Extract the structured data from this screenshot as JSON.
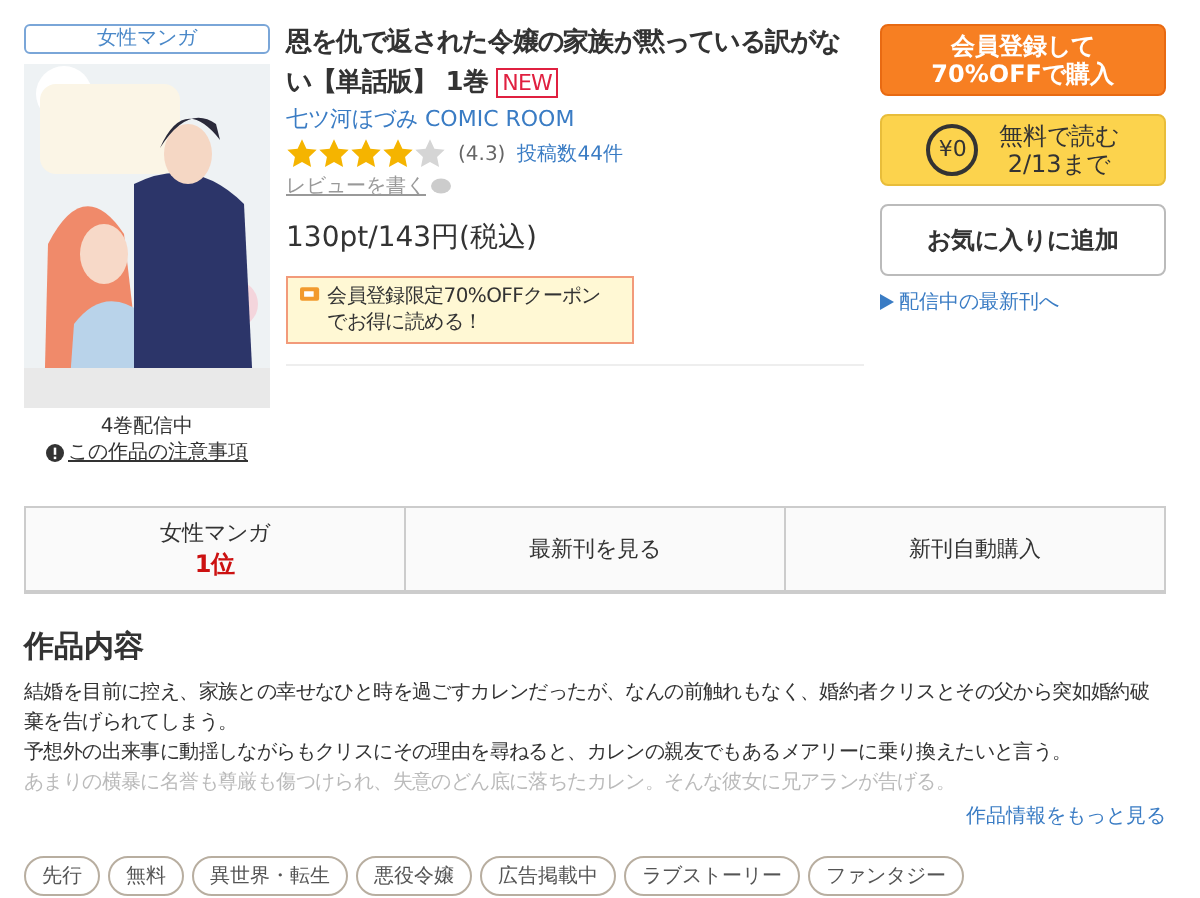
{
  "genre_badge": "女性マンガ",
  "title": "恩を仇で返された令嬢の家族が黙っている訳がない【単話版】 1巻",
  "new_badge": "NEW",
  "author": "七ツ河ほづみ COMIC ROOM",
  "rating": {
    "stars": 4,
    "score": "(4.3)",
    "reviews": "投稿数44件"
  },
  "write_review": "レビューを書く",
  "price": "130pt/143円(税込)",
  "coupon": "会員登録限定70%OFFクーポンでお得に読める！",
  "cover": {
    "kind": "picture",
    "volumes": "4巻配信中",
    "notice": "この作品の注意事項"
  },
  "buttons": [
    {
      "kind": "buy",
      "lines": [
        "会員登録して",
        "70%OFFで購入"
      ]
    },
    {
      "kind": "free",
      "icon_text": "¥0",
      "lines": [
        "無料で読む",
        "2/13まで"
      ]
    },
    {
      "kind": "favorite",
      "lines": [
        "お気に入りに追加"
      ]
    }
  ],
  "latest_link": "配信中の最新刊へ",
  "nav": [
    {
      "label": "女性マンガ",
      "sub": "1位"
    },
    {
      "label": "最新刊を見る"
    },
    {
      "label": "新刊自動購入"
    }
  ],
  "section_title": "作品内容",
  "description": [
    "結婚を目前に控え、家族との幸せなひと時を過ごすカレンだったが、なんの前触れもなく、婚約者クリスとその父から突如婚約破棄を告げられてしまう。",
    "予想外の出来事に動揺しながらもクリスにその理由を尋ねると、カレンの親友でもあるメアリーに乗り換えたいと言う。",
    "あまりの横暴に名誉も尊厳も傷つけられ、失意のどん底に落ちたカレン。そんな彼女に兄アランが告げる。"
  ],
  "more_link": "作品情報をもっと見る",
  "tags": [
    "先行",
    "無料",
    "異世界・転生",
    "悪役令嬢",
    "広告掲載中",
    "ラブストーリー",
    "ファンタジー"
  ]
}
